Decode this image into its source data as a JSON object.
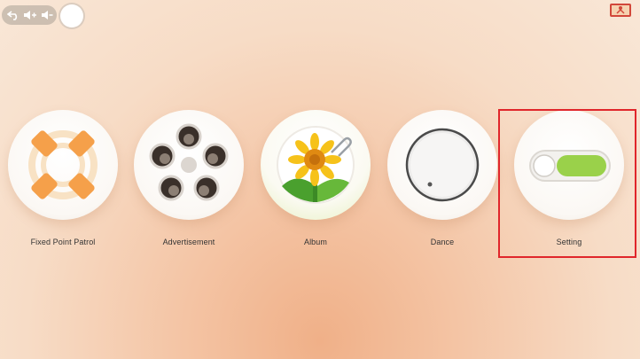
{
  "system_bar": {
    "icons": [
      "back-icon",
      "volume-up-icon",
      "volume-down-icon",
      "home-icon",
      "battery-low-icon"
    ],
    "colors": {
      "pill": "#aaa096",
      "battery_alert": "#d2473a"
    }
  },
  "apps": [
    {
      "label": "Fixed Point Patrol",
      "icon": "patrol-icon"
    },
    {
      "label": "Advertisement",
      "icon": "film-reel-icon"
    },
    {
      "label": "Album",
      "icon": "sunflower-icon"
    },
    {
      "label": "Dance",
      "icon": "dial-icon"
    },
    {
      "label": "Setting",
      "icon": "toggle-switch-icon",
      "highlighted": true
    }
  ],
  "colors": {
    "accent_orange": "#f5a04a",
    "toggle_green": "#9ad14a",
    "highlight_border": "#e0262b"
  }
}
